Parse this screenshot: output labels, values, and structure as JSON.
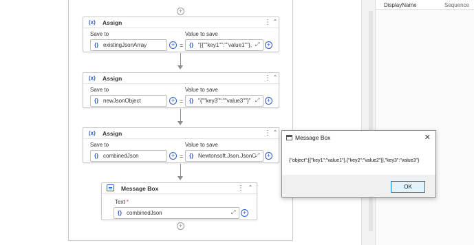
{
  "properties_panel": {
    "col_display_name": "DisplayName",
    "col_sequence": "Sequence"
  },
  "activities": [
    {
      "type": "Assign",
      "icon": "(x)",
      "save_to_label": "Save to",
      "value_label": "Value to save",
      "save_to": "existingJsonArray",
      "value": "\"[{\"\"key1\"\":\"\"value1\"\"},"
    },
    {
      "type": "Assign",
      "icon": "(x)",
      "save_to_label": "Save to",
      "value_label": "Value to save",
      "save_to": "newJsonObject",
      "value": "\"{\"\"key3\"\":\"\"value3\"\"}\""
    },
    {
      "type": "Assign",
      "icon": "(x)",
      "save_to_label": "Save to",
      "value_label": "Value to save",
      "save_to": "combinedJson",
      "value": "Newtonsoft.Json.JsonC"
    }
  ],
  "message_box_activity": {
    "title": "Message Box",
    "text_label": "Text",
    "required_mark": "*",
    "text_value": "combinedJson"
  },
  "symbols": {
    "brace": "{}",
    "equals": "=",
    "plus": "+",
    "kebab": "⋮",
    "collapse": "⌃",
    "expand": "⤢"
  },
  "dialog": {
    "title": "Message Box",
    "message": "{\"object\":[{\"key1\":\"value1\"},{\"key2\":\"value2\"}],\"key3\":\"value3\"}",
    "ok_label": "OK",
    "close": "✕"
  },
  "colors": {
    "accent": "#2b5bc9",
    "ok_border": "#0078d7",
    "required": "#d13438"
  }
}
